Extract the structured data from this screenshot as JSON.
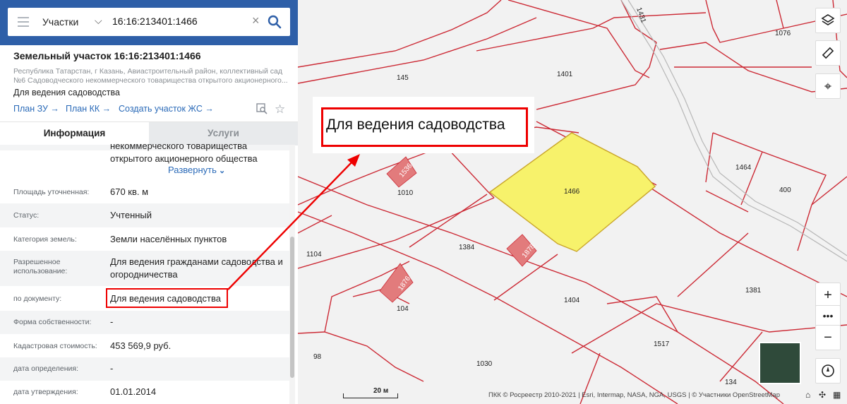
{
  "search": {
    "select_label": "Участки",
    "query": "16:16:213401:1466"
  },
  "parcel": {
    "title": "Земельный участок 16:16:213401:1466",
    "address": "Республика Татарстан, г Казань, Авиастроительный район, коллективный сад №6 Садоводческого некоммерческого товарищества открытого акционерного...",
    "purpose": "Для ведения садоводства",
    "links": [
      "План ЗУ →",
      "План КК →",
      "Создать участок ЖС →"
    ]
  },
  "tabs": [
    "Информация",
    "Услуги"
  ],
  "info": {
    "truncated_lines": [
      "некоммерческого товарищества",
      "открытого акционерного общества"
    ],
    "expand_label": "Развернуть",
    "rows": [
      {
        "label": "Площадь уточненная:",
        "value": "670 кв. м"
      },
      {
        "label": "Статус:",
        "value": "Учтенный"
      },
      {
        "label": "Категория земель:",
        "value": "Земли населённых пунктов"
      },
      {
        "label": "Разрешенное использование:",
        "value": "Для ведения гражданами садоводства и огородничества"
      },
      {
        "label": "по документу:",
        "value": "Для ведения садоводства"
      },
      {
        "label": "Форма собственности:",
        "value": "-"
      },
      {
        "label": "Кадастровая стоимость:",
        "value": "453 569,9 руб."
      },
      {
        "label": "дата определения:",
        "value": "-"
      },
      {
        "label": "дата утверждения:",
        "value": "01.01.2014"
      }
    ]
  },
  "map": {
    "callout_text": "Для ведения садоводства",
    "parcel_labels": [
      "1431",
      "1076",
      "1401",
      "145",
      "1536",
      "1010",
      "1464",
      "400",
      "1466",
      "1104",
      "1384",
      "1878",
      "1381",
      "1876",
      "104",
      "1404",
      "98",
      "1030",
      "1517",
      "134"
    ],
    "scale_label": "20 м",
    "attribution": "ПКК © Росреестр 2010-2021 | Esri, Intermap, NASA, NGA, USGS | © Участники OpenStreetMap",
    "highlight_color": "#f7f26b",
    "boundary_color": "#cc2a35",
    "accent_color": "#2e5fa8"
  }
}
